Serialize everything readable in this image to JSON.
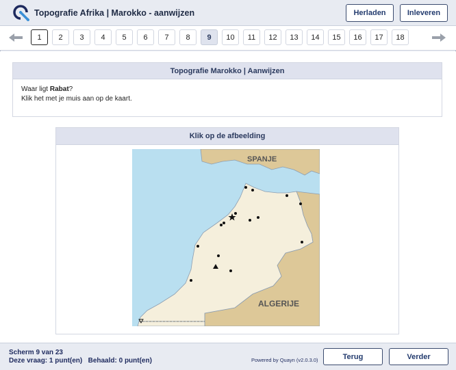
{
  "header": {
    "title": "Topografie Afrika | Marokko - aanwijzen",
    "reload_label": "Herladen",
    "submit_label": "Inleveren"
  },
  "pager": {
    "pages": [
      "1",
      "2",
      "3",
      "4",
      "5",
      "6",
      "7",
      "8",
      "9",
      "10",
      "11",
      "12",
      "13",
      "14",
      "15",
      "16",
      "17",
      "18"
    ],
    "current_outlined": "1",
    "active_page": "9",
    "prev_icon": "arrow-left-icon",
    "next_icon": "arrow-right-icon"
  },
  "question": {
    "heading": "Topografie Marokko | Aanwijzen",
    "prefix": "Waar ligt ",
    "place": "Rabat",
    "suffix": "?",
    "instruction": "Klik het met je muis aan op de kaart."
  },
  "map_panel": {
    "heading": "Klik op de afbeelding",
    "label_spain": "SPANJE",
    "label_algeria": "ALGERIJE"
  },
  "footer": {
    "screen": "Scherm 9 van 23",
    "question_points": "Deze vraag: 1 punt(en)",
    "earned_points": "Behaald: 0 punt(en)",
    "powered_by": "Powered by Quayn (v2.0.3.0)",
    "back_label": "Terug",
    "next_label": "Verder"
  },
  "colors": {
    "sea": "#b9dff0",
    "morocco": "#f5efdc",
    "neighbour": "#ddc898",
    "accent": "#233b6e",
    "active_page_bg": "#dfe3ee"
  }
}
